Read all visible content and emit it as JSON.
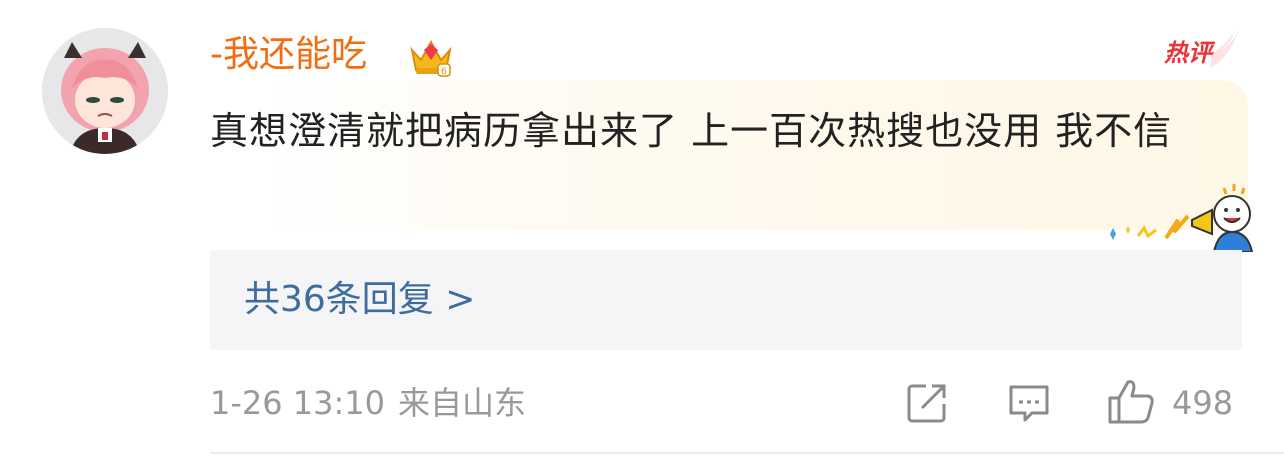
{
  "comment": {
    "username": "-我还能吃",
    "badge": "热评",
    "text": "真想澄清就把病历拿出来了 上一百次热搜也没用 我不信",
    "replies_label": "共36条回复 >",
    "time": "1-26 13:10",
    "location": "来自山东",
    "like_count": "498"
  },
  "colors": {
    "username": "#f26d10",
    "hot_badge": "#e8343a",
    "link": "#3d6c9e",
    "meta": "#999999"
  },
  "icons": {
    "crown": "crown-vip-icon",
    "share": "share-icon",
    "comment": "comment-icon",
    "like": "like-icon",
    "sticker": "megaphone-cheer-sticker"
  }
}
